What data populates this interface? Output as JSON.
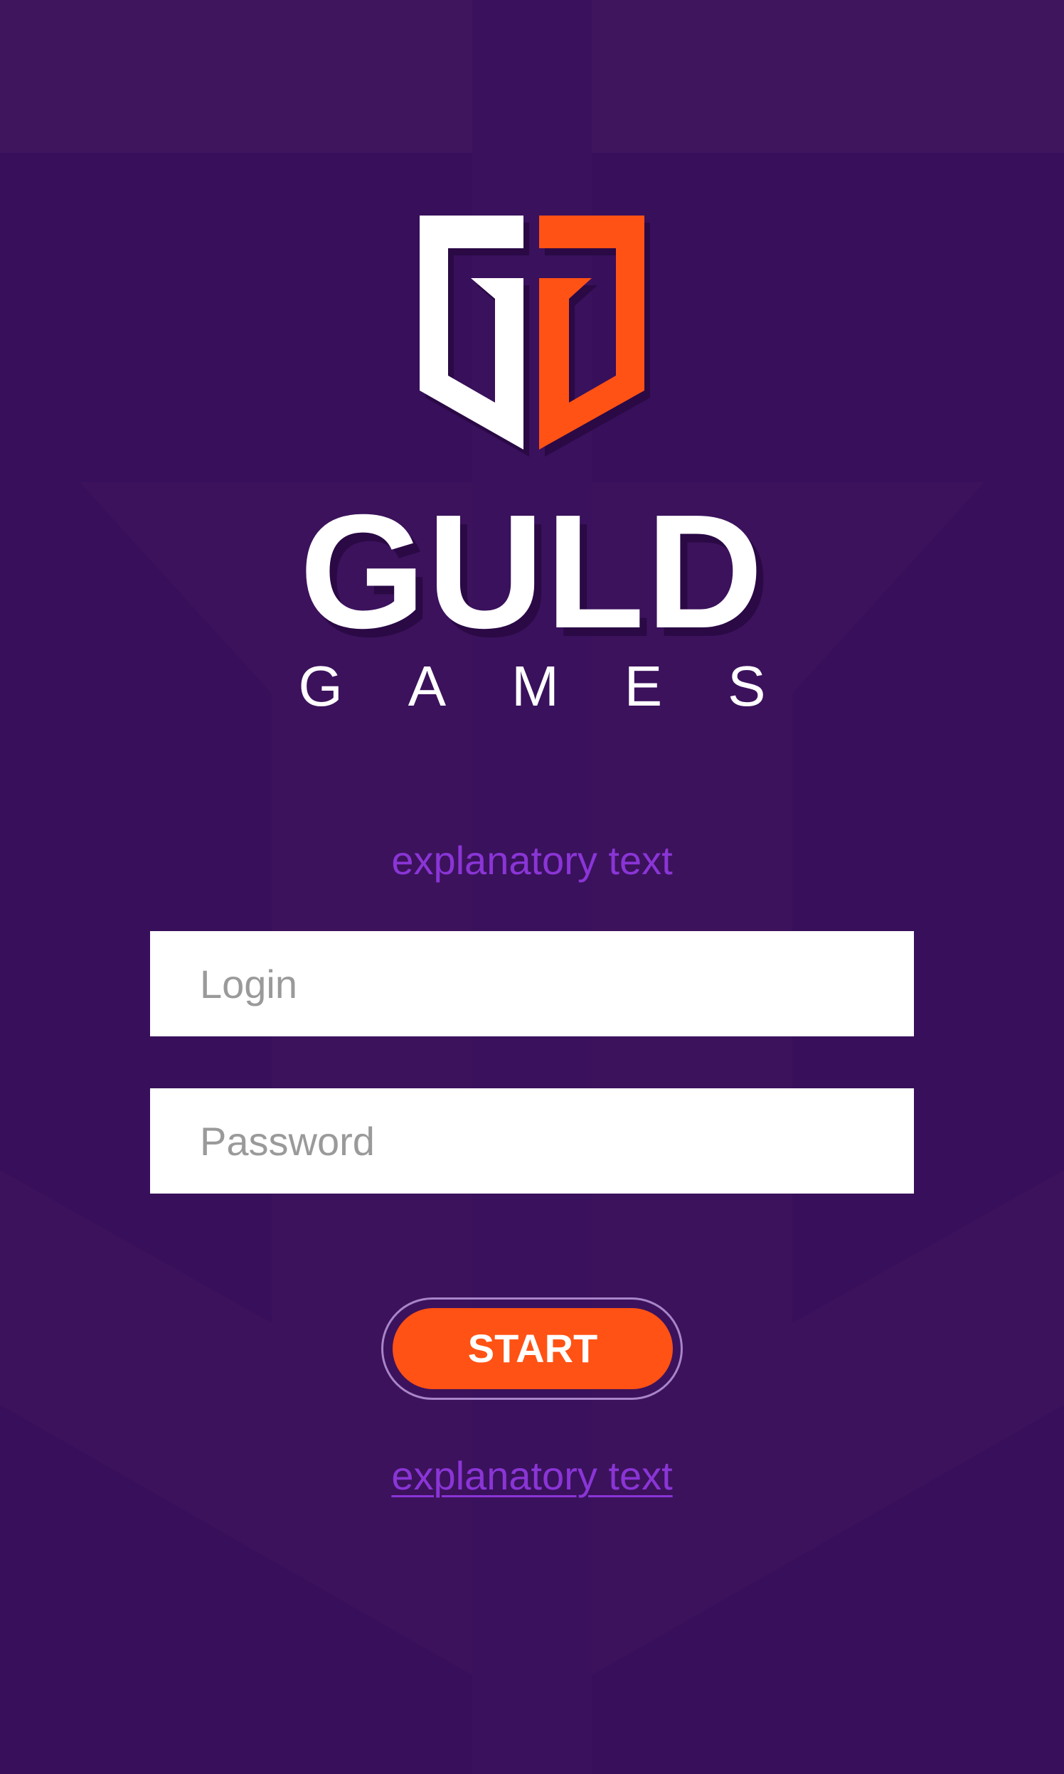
{
  "brand": {
    "name": "GULD",
    "subtitle": "GAMES"
  },
  "colors": {
    "background": "#380f5a",
    "panel": "#3f155e",
    "accent": "#ff5214",
    "link": "#8a35d6",
    "logo_white": "#ffffff",
    "logo_orange": "#ff5214"
  },
  "icons": {
    "logo": "gg-shield-logo-icon"
  },
  "form": {
    "explanatory_top": "explanatory text",
    "login": {
      "placeholder": "Login",
      "value": ""
    },
    "password": {
      "placeholder": "Password",
      "value": ""
    },
    "start_label": "START",
    "explanatory_link": "explanatory text"
  }
}
